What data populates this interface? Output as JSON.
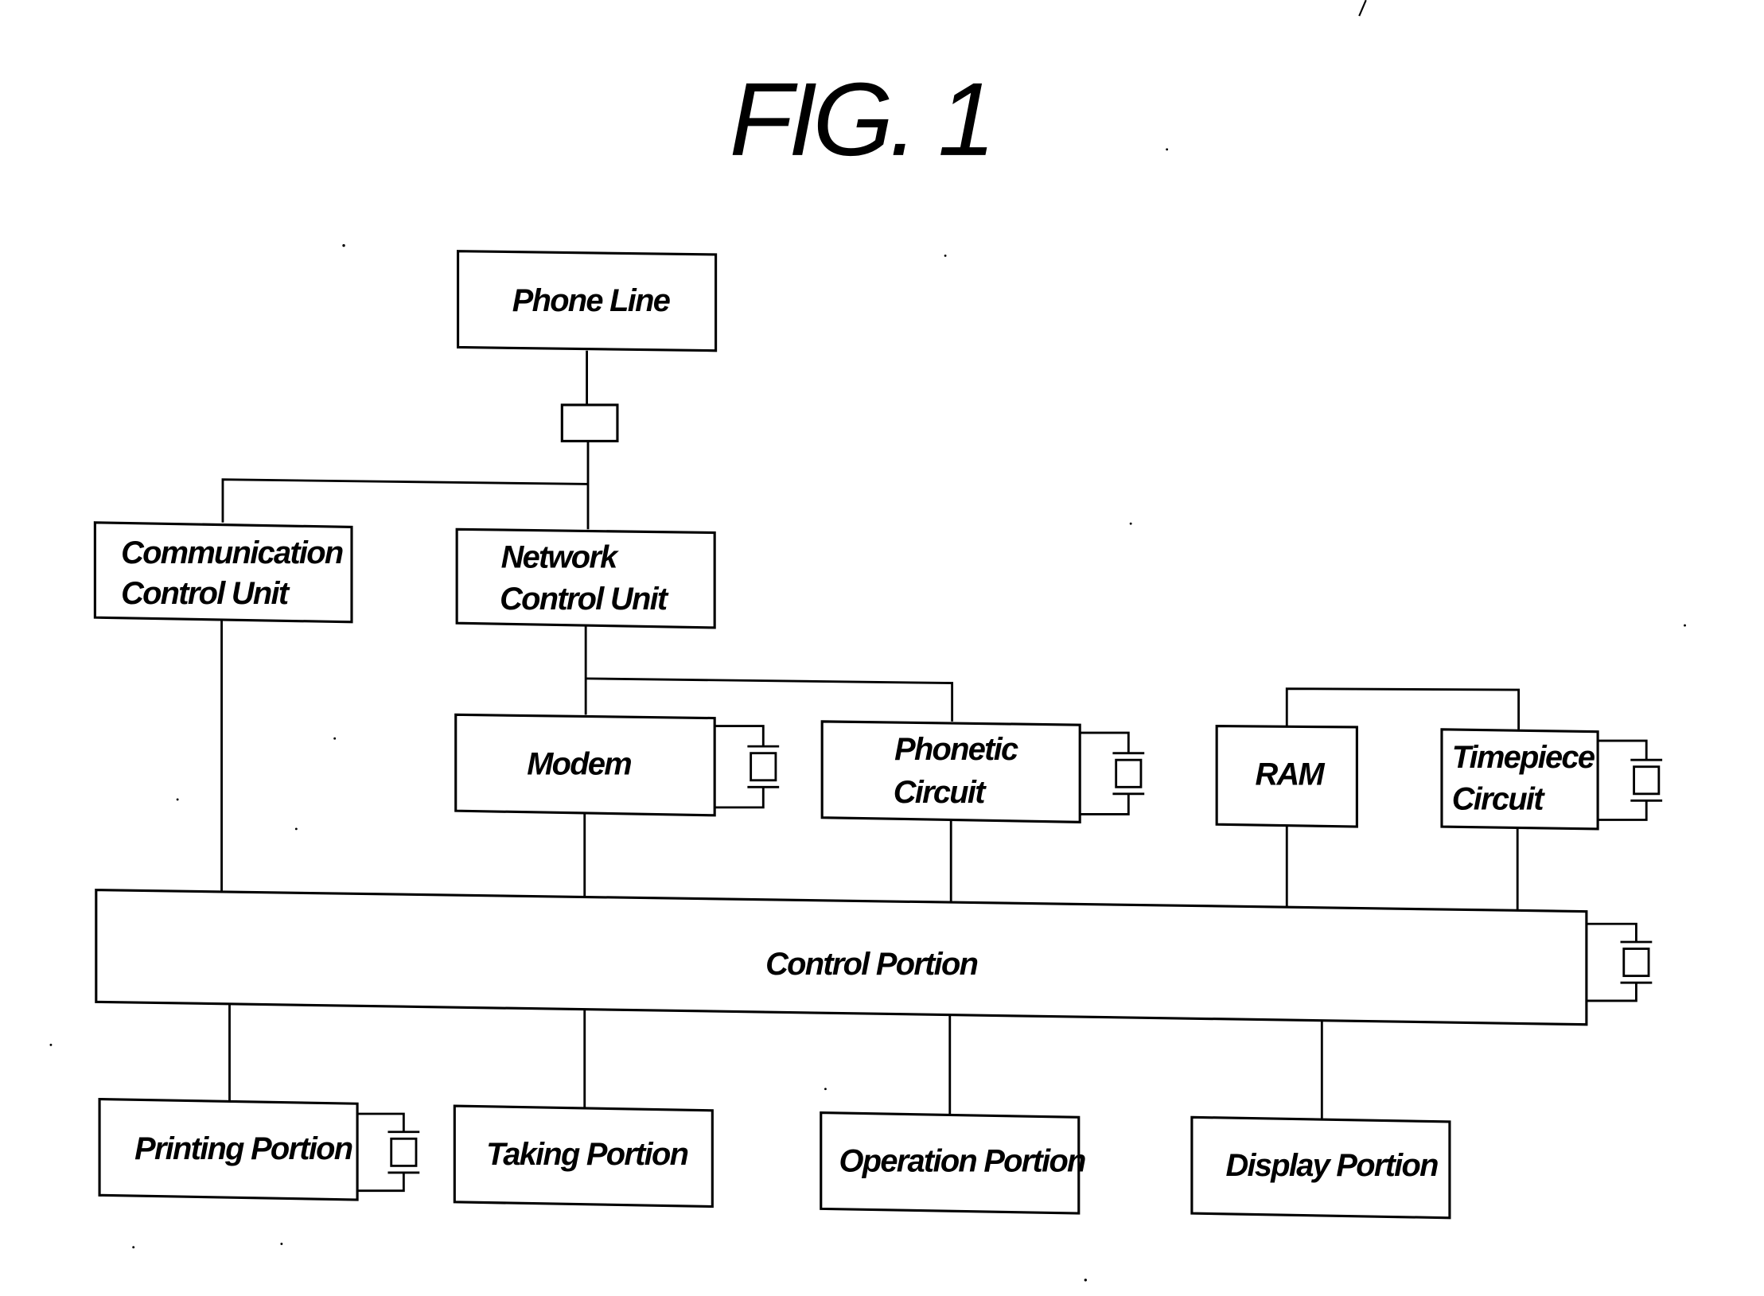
{
  "figure": {
    "title": "FIG. 1"
  },
  "blocks": {
    "phone_line": {
      "lines": [
        "Phone Line"
      ]
    },
    "communication_control_unit": {
      "lines": [
        "Communication",
        "Control Unit"
      ]
    },
    "network_control_unit": {
      "lines": [
        "Network",
        "Control Unit"
      ]
    },
    "modem": {
      "lines": [
        "Modem"
      ]
    },
    "phonetic_circuit": {
      "lines": [
        "Phonetic",
        "Circuit"
      ]
    },
    "ram": {
      "lines": [
        "RAM"
      ]
    },
    "timepiece_circuit": {
      "lines": [
        "Timepiece",
        "Circuit"
      ]
    },
    "control_portion": {
      "lines": [
        "Control Portion"
      ]
    },
    "printing_portion": {
      "lines": [
        "Printing Portion"
      ]
    },
    "taking_portion": {
      "lines": [
        "Taking Portion"
      ]
    },
    "operation_portion": {
      "lines": [
        "Operation Portion"
      ]
    },
    "display_portion": {
      "lines": [
        "Display Portion"
      ]
    }
  },
  "connections": [
    [
      "phone_line",
      "line_junction"
    ],
    [
      "line_junction",
      "communication_control_unit"
    ],
    [
      "line_junction",
      "network_control_unit"
    ],
    [
      "network_control_unit",
      "modem"
    ],
    [
      "network_control_unit",
      "phonetic_circuit"
    ],
    [
      "ram",
      "timepiece_circuit"
    ],
    [
      "communication_control_unit",
      "control_portion"
    ],
    [
      "modem",
      "control_portion"
    ],
    [
      "phonetic_circuit",
      "control_portion"
    ],
    [
      "ram",
      "control_portion"
    ],
    [
      "timepiece_circuit",
      "control_portion"
    ],
    [
      "control_portion",
      "printing_portion"
    ],
    [
      "control_portion",
      "taking_portion"
    ],
    [
      "control_portion",
      "operation_portion"
    ],
    [
      "control_portion",
      "display_portion"
    ]
  ],
  "oscillators_on": [
    "modem",
    "phonetic_circuit",
    "timepiece_circuit",
    "control_portion",
    "printing_portion"
  ]
}
